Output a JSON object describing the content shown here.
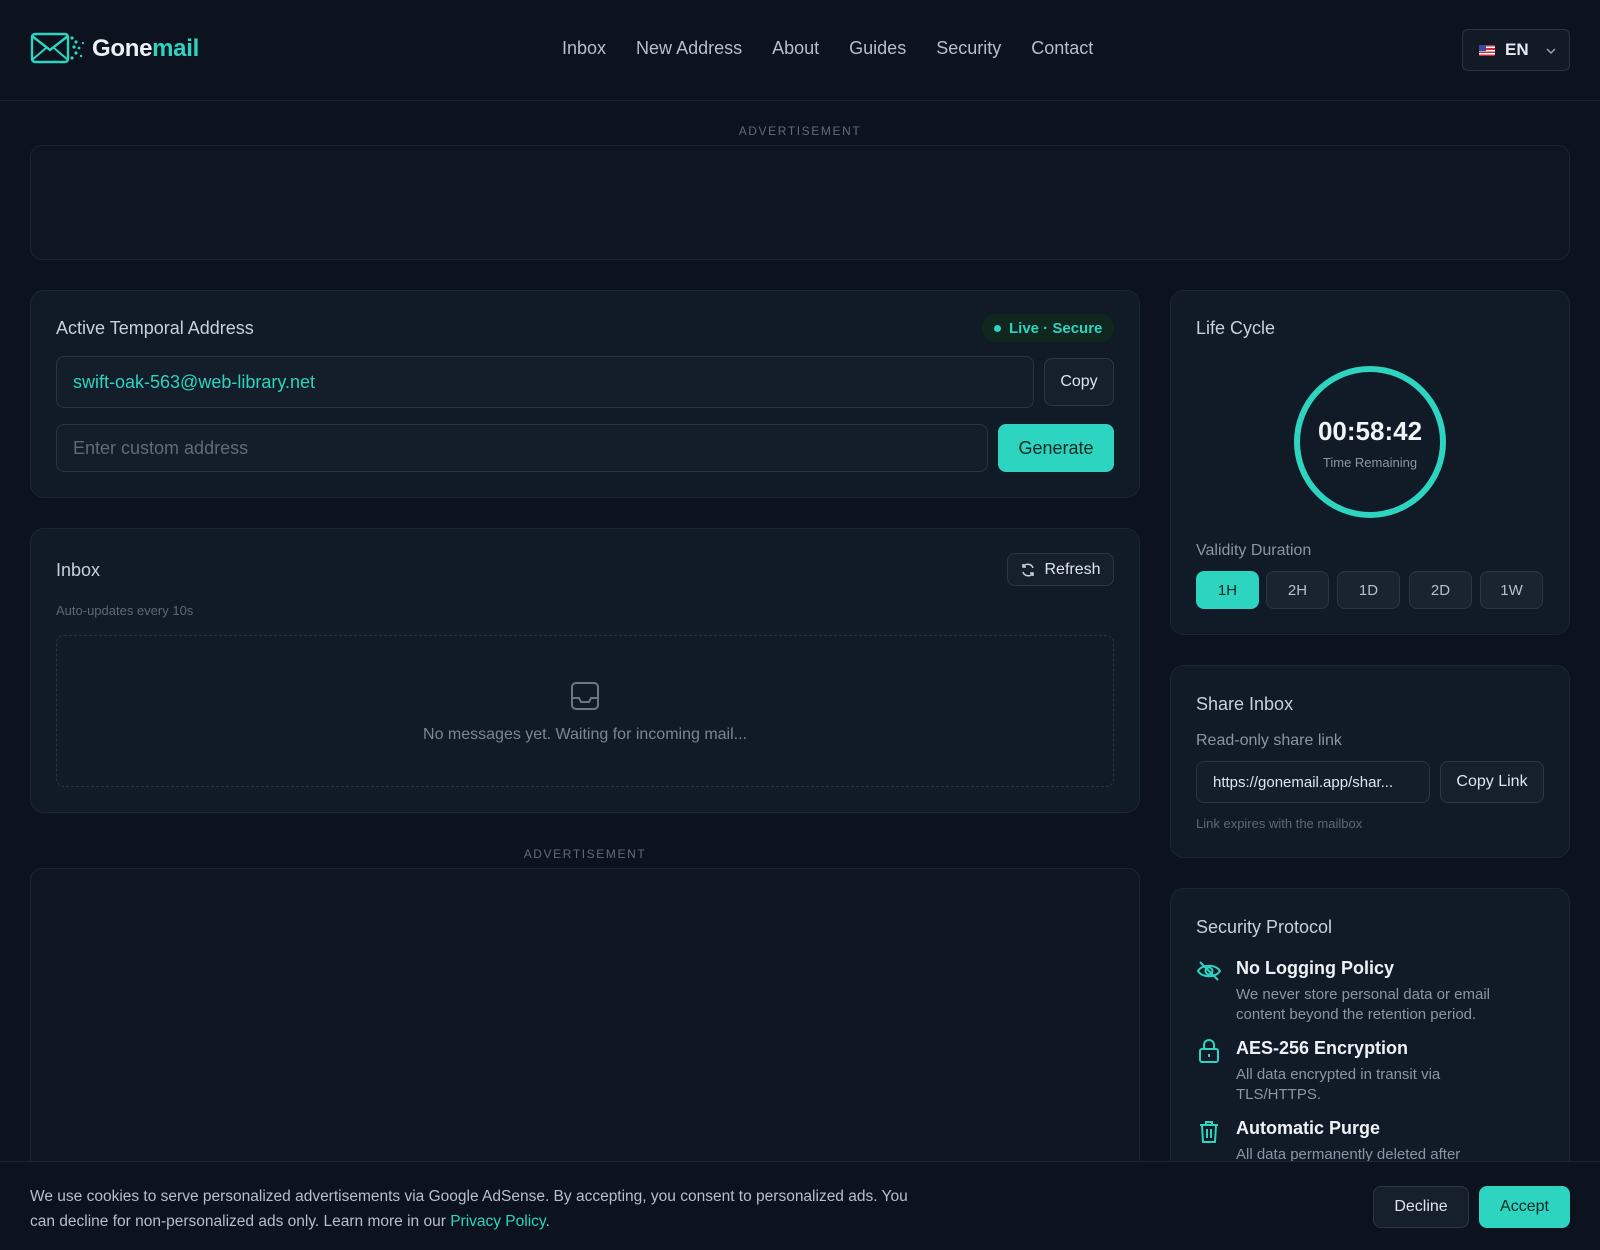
{
  "brand": {
    "name_a": "Gone",
    "name_b": "mail",
    "accent": "#2dd4bf",
    "background": "#0c131f"
  },
  "nav": {
    "items": [
      "Inbox",
      "New Address",
      "About",
      "Guides",
      "Security",
      "Contact"
    ]
  },
  "language": {
    "code": "EN",
    "flag": "us-flag-icon"
  },
  "ads": {
    "top_label": "ADVERTISEMENT",
    "mid_label": "ADVERTISEMENT"
  },
  "address_card": {
    "title": "Active Temporal Address",
    "status": "Live · Secure",
    "address": "swift-oak-563@web-library.net",
    "copy_label": "Copy",
    "custom_placeholder": "Enter custom address",
    "generate_label": "Generate"
  },
  "inbox": {
    "title": "Inbox",
    "refresh_label": "Refresh",
    "subtitle": "Auto-updates every 10s",
    "empty_text": "No messages yet. Waiting for incoming mail..."
  },
  "lifecycle": {
    "title": "Life Cycle",
    "time": "00:58:42",
    "time_label": "Time Remaining",
    "ring_fraction": 1.0,
    "validity_label": "Validity Duration",
    "durations": [
      "1H",
      "2H",
      "1D",
      "2D",
      "1W"
    ],
    "selected": "1H"
  },
  "share": {
    "title": "Share Inbox",
    "label": "Read-only share link",
    "link": "https://gonemail.app/shar...",
    "copy_label": "Copy Link",
    "note": "Link expires with the mailbox"
  },
  "security": {
    "title": "Security Protocol",
    "items": [
      {
        "icon": "eye-off-icon",
        "title": "No Logging Policy",
        "desc": "We never store personal data or email content beyond the retention period."
      },
      {
        "icon": "lock-icon",
        "title": "AES-256 Encryption",
        "desc": "All data encrypted in transit via TLS/HTTPS."
      },
      {
        "icon": "trash-icon",
        "title": "Automatic Purge",
        "desc": "All data permanently deleted after"
      }
    ]
  },
  "cookie": {
    "text": "We use cookies to serve personalized advertisements via Google AdSense. By accepting, you consent to personalized ads. You can decline for non-personalized ads only. Learn more in our ",
    "link": "Privacy Policy",
    "end": ".",
    "decline": "Decline",
    "accept": "Accept"
  }
}
